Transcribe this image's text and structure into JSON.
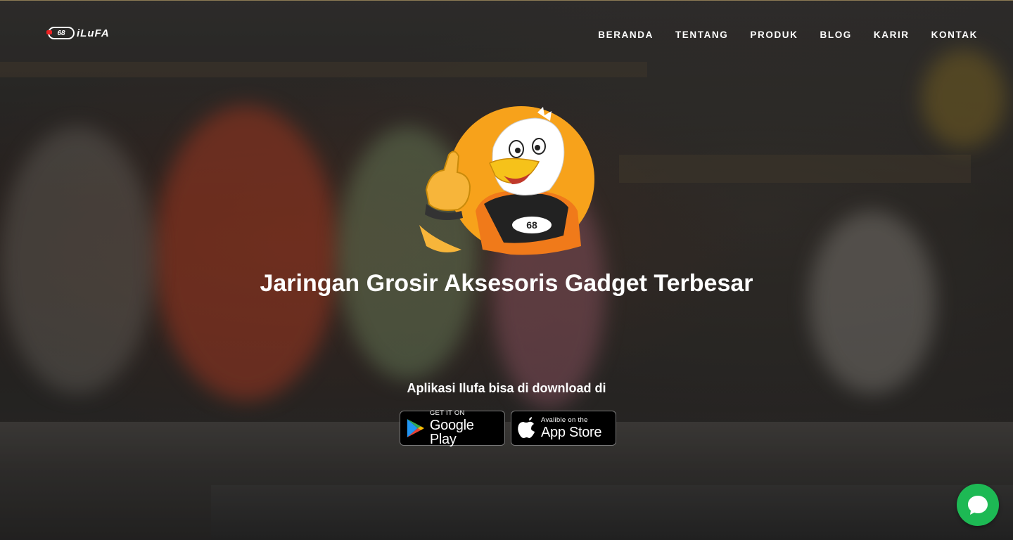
{
  "brand": {
    "logo_mark": "68",
    "logo_text": "iLuFA"
  },
  "nav": {
    "items": [
      "BERANDA",
      "TENTANG",
      "PRODUK",
      "BLOG",
      "KARIR",
      "KONTAK"
    ]
  },
  "mascot": {
    "badge": "68"
  },
  "hero": {
    "headline": "Jaringan Grosir Aksesoris Gadget Terbesar",
    "download_text": "Aplikasi Ilufa bisa di download di"
  },
  "stores": {
    "google": {
      "small": "GET IT ON",
      "big": "Google Play"
    },
    "apple": {
      "small": "Avalible on the",
      "big": "App Store"
    }
  },
  "colors": {
    "mascot_circle": "#f7a21b",
    "chat_button": "#1db954",
    "logo_accent": "#e22222"
  },
  "icons": [
    "google-play-icon",
    "apple-icon",
    "chat-bubble-icon"
  ]
}
